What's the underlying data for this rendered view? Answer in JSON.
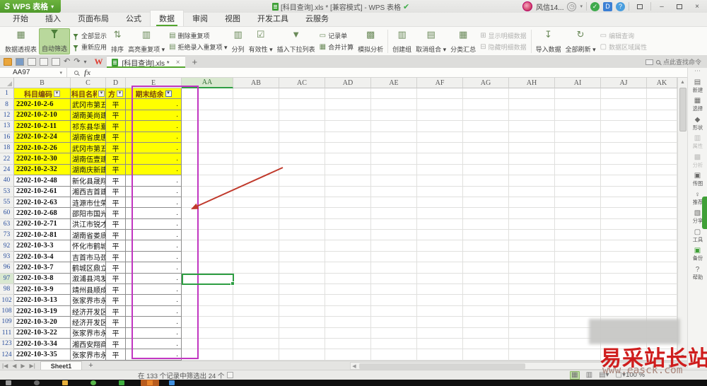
{
  "titlebar": {
    "app_button_label": "WPS 表格",
    "doc_title": "[科目查询].xls * [兼容模式] - WPS 表格",
    "user_name": "风信14...",
    "minimize": "–",
    "close": "×"
  },
  "menu_tabs": [
    {
      "label": "开始"
    },
    {
      "label": "插入"
    },
    {
      "label": "页面布局"
    },
    {
      "label": "公式"
    },
    {
      "label": "数据",
      "active": true
    },
    {
      "label": "审阅"
    },
    {
      "label": "视图"
    },
    {
      "label": "开发工具"
    },
    {
      "label": "云服务"
    }
  ],
  "ribbon": {
    "pivot_table": "数据透视表",
    "auto_filter": "自动筛选",
    "show_all": "全部显示",
    "reapply": "重新应用",
    "sort": "排序",
    "highlight_dups": "高亮重复项 ▾",
    "remove_dups": "删除重复项",
    "reject_dups": "拒绝录入重复项 ▾",
    "text_to_cols": "分列",
    "validation": "有效性 ▾",
    "insert_dropdown": "插入下拉列表",
    "record_form": "记录单",
    "consolidate": "合并计算",
    "what_if": "模拟分析",
    "create_group": "创建组",
    "ungroup": "取消组合 ▾",
    "subtotal": "分类汇总",
    "show_detail": "显示明细数据",
    "hide_detail": "隐藏明细数据",
    "import_data": "导入数据",
    "refresh_all": "全部刷新 ▾",
    "edit_query": "编辑查询",
    "data_range_props": "数据区域属性"
  },
  "doc_tab": {
    "label": "[科目查询].xls *",
    "close": "×",
    "new_tab": "+"
  },
  "find_command_label": "点此查找命令",
  "formula_bar": {
    "cell_ref": "AA97",
    "fx_label": "fx"
  },
  "grid": {
    "columns": [
      "B",
      "C",
      "D",
      "E",
      "AA",
      "AB",
      "AC",
      "AD",
      "AE",
      "AF",
      "AG",
      "AH",
      "AI",
      "AJ",
      "AK"
    ],
    "selected_column": "AA",
    "selected_cell": "AA97",
    "header_row": {
      "num": "1",
      "code": "科目编码",
      "name": "科目名称",
      "dir": "方",
      "balance": "期末结余"
    },
    "rows": [
      {
        "num": "8",
        "code": "2202-10-2-6",
        "name": "武冈市第五建",
        "dir": "平",
        "val": ".",
        "hl": true
      },
      {
        "num": "12",
        "code": "2202-10-2-10",
        "name": "湖南美尚建筑",
        "dir": "平",
        "val": ".",
        "hl": true
      },
      {
        "num": "13",
        "code": "2202-10-2-11",
        "name": "祁东县华夏建",
        "dir": "平",
        "val": ".",
        "hl": true
      },
      {
        "num": "16",
        "code": "2202-10-2-24",
        "name": "湖南省虞唐建",
        "dir": "平",
        "val": ".",
        "hl": true
      },
      {
        "num": "18",
        "code": "2202-10-2-26",
        "name": "武冈市第五建",
        "dir": "平",
        "val": ".",
        "hl": true
      },
      {
        "num": "22",
        "code": "2202-10-2-30",
        "name": "湖南伍壹建设",
        "dir": "平",
        "val": ".",
        "hl": true
      },
      {
        "num": "24",
        "code": "2202-10-2-32",
        "name": "湖南庆新建设",
        "dir": "平",
        "val": ".",
        "hl": true
      },
      {
        "num": "40",
        "code": "2202-10-2-48",
        "name": "新化县晟翔建",
        "dir": "平",
        "val": "."
      },
      {
        "num": "53",
        "code": "2202-10-2-61",
        "name": "湘西吉首建筑",
        "dir": "平",
        "val": "."
      },
      {
        "num": "55",
        "code": "2202-10-2-63",
        "name": "涟源市仕荣工",
        "dir": "平",
        "val": "."
      },
      {
        "num": "60",
        "code": "2202-10-2-68",
        "name": "邵阳市国光劳",
        "dir": "平",
        "val": "."
      },
      {
        "num": "63",
        "code": "2202-10-2-71",
        "name": "洪江市锐才劳",
        "dir": "平",
        "val": "."
      },
      {
        "num": "73",
        "code": "2202-10-2-81",
        "name": "湖南省娄底市",
        "dir": "平",
        "val": "."
      },
      {
        "num": "92",
        "code": "2202-10-3-3",
        "name": "怀化市鹤城区",
        "dir": "平",
        "val": "."
      },
      {
        "num": "93",
        "code": "2202-10-3-4",
        "name": "吉首市马颈坳",
        "dir": "平",
        "val": "."
      },
      {
        "num": "96",
        "code": "2202-10-3-7",
        "name": "鹤城区鼎立五",
        "dir": "平",
        "val": "."
      },
      {
        "num": "97",
        "code": "2202-10-3-8",
        "name": "溆浦县鸿发建",
        "dir": "平",
        "val": ".",
        "selected": true
      },
      {
        "num": "98",
        "code": "2202-10-3-9",
        "name": "靖州县顺成机",
        "dir": "平",
        "val": "."
      },
      {
        "num": "102",
        "code": "2202-10-3-13",
        "name": "张家界市永定",
        "dir": "平",
        "val": "."
      },
      {
        "num": "108",
        "code": "2202-10-3-19",
        "name": "经济开发区兄",
        "dir": "平",
        "val": "."
      },
      {
        "num": "109",
        "code": "2202-10-3-20",
        "name": "经济开发区信",
        "dir": "平",
        "val": "."
      },
      {
        "num": "111",
        "code": "2202-10-3-22",
        "name": "张家界市永定",
        "dir": "平",
        "val": "."
      },
      {
        "num": "123",
        "code": "2202-10-3-34",
        "name": "湘西安翔商贸",
        "dir": "平",
        "val": "."
      },
      {
        "num": "124",
        "code": "2202-10-3-35",
        "name": "张家界市永定",
        "dir": "平",
        "val": "."
      }
    ]
  },
  "sheet_bar": {
    "sheet_name": "Sheet1",
    "add_label": "+"
  },
  "status_bar": {
    "filter_summary": "在 133 个记录中筛选出 24 个",
    "zoom_level": "100 %"
  },
  "sidebar": [
    {
      "label": "新建",
      "icon": "new-document-icon",
      "glyph": "▤"
    },
    {
      "label": "选择",
      "icon": "select-icon",
      "glyph": "▦"
    },
    {
      "label": "形状",
      "icon": "shapes-icon",
      "glyph": "◆"
    },
    {
      "label": "属性",
      "icon": "properties-icon",
      "glyph": "▥",
      "disabled": true
    },
    {
      "label": "分析",
      "icon": "analysis-icon",
      "glyph": "▩",
      "disabled": true
    },
    {
      "label": "传图",
      "icon": "upload-image-icon",
      "glyph": "▣"
    },
    {
      "label": "推荐",
      "icon": "recommend-icon",
      "glyph": "♀"
    },
    {
      "label": "分享",
      "icon": "share-icon",
      "glyph": "▧"
    },
    {
      "label": "工具",
      "icon": "tools-icon",
      "glyph": "▢"
    },
    {
      "label": "备份",
      "icon": "backup-icon",
      "glyph": "▣",
      "backup": true
    },
    {
      "label": "帮助",
      "icon": "help-icon",
      "glyph": "?"
    }
  ],
  "watermark": {
    "site_name": "易采站长站",
    "site_url": "www.easck.com"
  },
  "colors": {
    "wps_green": "#54a62f",
    "highlight_yellow": "#ffff00",
    "annotation_purple": "#c136c1",
    "annotation_red": "#c0392b",
    "selection_green": "#2e9e43"
  }
}
